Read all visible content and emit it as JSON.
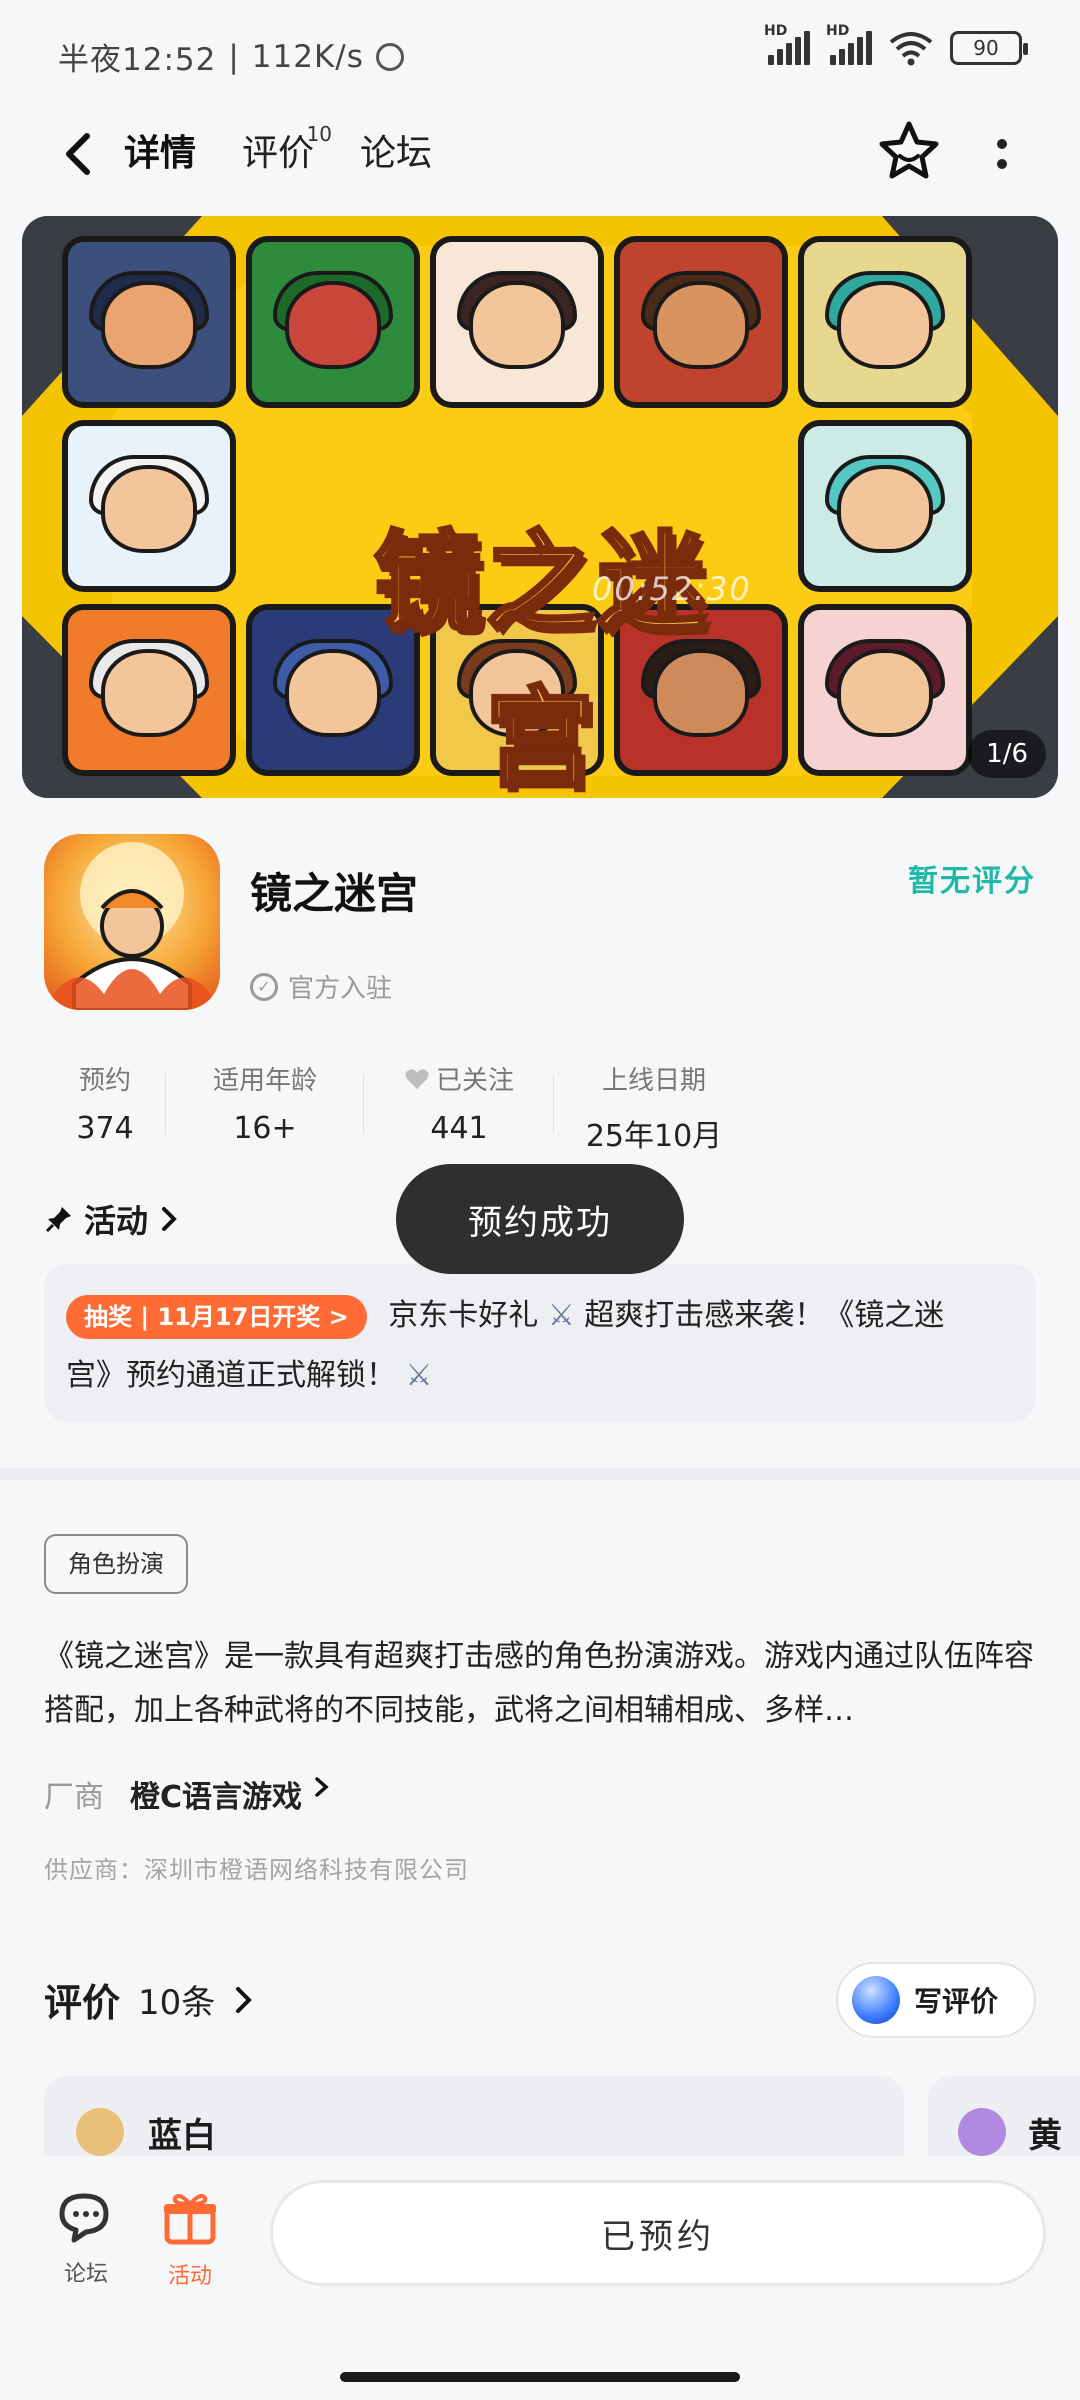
{
  "status_bar": {
    "time": "半夜12:52",
    "speed": "112K/s",
    "signal_1": "HD",
    "signal_2": "HD",
    "battery": "90"
  },
  "nav": {
    "tabs": [
      {
        "label": "详情",
        "active": true
      },
      {
        "label": "评价",
        "badge": "10"
      },
      {
        "label": "论坛"
      }
    ]
  },
  "banner": {
    "title": "镜之迷宫",
    "timer": "00:52:30",
    "page": "1/6",
    "bg_color": "#f5c400"
  },
  "app": {
    "name": "镜之迷宫",
    "official": "官方入驻",
    "score": "暂无评分"
  },
  "stats": [
    {
      "label": "预约",
      "value": "374"
    },
    {
      "label": "适用年龄",
      "value": "16+"
    },
    {
      "label": "已关注",
      "value": "441"
    },
    {
      "label": "上线日期",
      "value": "25年10月"
    }
  ],
  "activity": {
    "title": "活动",
    "toast": "预约成功",
    "badge": "抽奖 | 11月17日开奖 >",
    "text_1": "京东卡好礼",
    "text_2": "超爽打击感来袭！《镜之迷",
    "text_3": "宫》预约通道正式解锁！"
  },
  "about": {
    "genre": "角色扮演",
    "description": "《镜之迷宫》是一款具有超爽打击感的角色扮演游戏。游戏内通过队伍阵容搭配，加上各种武将的不同技能，武将之间相辅相成、多样…",
    "developer_label": "厂商",
    "developer": "橙C语言游戏",
    "supplier": "供应商：深圳市橙语网络科技有限公司"
  },
  "reviews": {
    "title": "评价",
    "count": "10条",
    "write": "写评价",
    "cards": [
      {
        "user": "蓝白"
      },
      {
        "user": "黄色"
      }
    ]
  },
  "bottom": {
    "forum": "论坛",
    "activity": "活动",
    "reserved": "已预约"
  },
  "colors": {
    "accent": "#22c7b8",
    "orange": "#ff6b35",
    "score": "#22b8a8"
  }
}
